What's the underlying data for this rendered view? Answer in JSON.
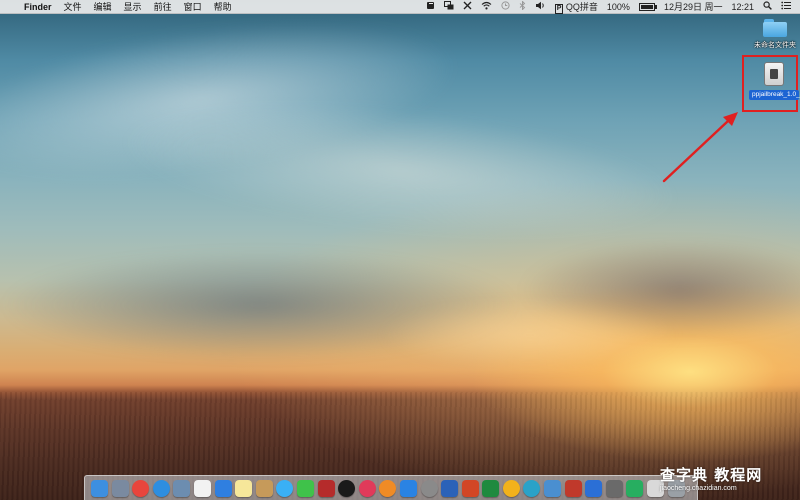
{
  "menubar": {
    "apple": "",
    "app_name": "Finder",
    "menus": [
      "文件",
      "编辑",
      "显示",
      "前往",
      "窗口",
      "帮助"
    ],
    "status": {
      "ime_box": "P",
      "ime_name": "QQ拼音",
      "battery_percent": "100%",
      "battery_level": 1.0,
      "date": "12月29日 周一",
      "time": "12:21"
    },
    "status_icons": [
      "evernote-icon",
      "screen-sharing-icon",
      "tools-icon",
      "wifi-icon",
      "time-machine-icon",
      "bluetooth-icon",
      "volume-icon",
      "input-method-icon",
      "battery-icon",
      "spotlight-icon",
      "notification-center-icon"
    ]
  },
  "desktop": {
    "folder": {
      "label": "未命名文件夹"
    },
    "dmg": {
      "label": "ppjailbreak_1.0_2....dmg"
    }
  },
  "dock": {
    "apps": [
      {
        "name": "finder-icon",
        "color": "#3d8fe0"
      },
      {
        "name": "launchpad-icon",
        "color": "#7a8aa0"
      },
      {
        "name": "chrome-icon",
        "color": "#e8453c"
      },
      {
        "name": "safari-icon",
        "color": "#2e8ee0"
      },
      {
        "name": "preview-icon",
        "color": "#6c8db0"
      },
      {
        "name": "calendar-icon",
        "color": "#f2f2f2"
      },
      {
        "name": "app-store-icon",
        "color": "#2f7fe0"
      },
      {
        "name": "notes-icon",
        "color": "#f6e79a"
      },
      {
        "name": "contacts-icon",
        "color": "#c69a5a"
      },
      {
        "name": "messages-icon",
        "color": "#3ab0f5"
      },
      {
        "name": "facetime-icon",
        "color": "#3fc24a"
      },
      {
        "name": "photo-booth-icon",
        "color": "#b52b2b"
      },
      {
        "name": "qq-icon",
        "color": "#1a1a1a"
      },
      {
        "name": "itunes-icon",
        "color": "#e03a5a"
      },
      {
        "name": "ibooks-icon",
        "color": "#f08b25"
      },
      {
        "name": "app-store-blue-icon",
        "color": "#2a83e3"
      },
      {
        "name": "system-preferences-icon",
        "color": "#8a8a8a"
      },
      {
        "name": "word-icon",
        "color": "#2b62b8"
      },
      {
        "name": "powerpoint-icon",
        "color": "#d24625"
      },
      {
        "name": "excel-icon",
        "color": "#1f8a3f"
      },
      {
        "name": "outlook-icon",
        "color": "#f2b21b"
      },
      {
        "name": "onenote-icon",
        "color": "#2aa2c8"
      },
      {
        "name": "image-capture-icon",
        "color": "#4a8fd0"
      },
      {
        "name": "crossover-icon",
        "color": "#c0392b"
      },
      {
        "name": "thunder-icon",
        "color": "#2b6fd6"
      },
      {
        "name": "screenshot-icon",
        "color": "#6a6a6a"
      },
      {
        "name": "activity-icon",
        "color": "#27ae60"
      },
      {
        "name": "downloads-stack-icon",
        "color": "#d9d9d9"
      },
      {
        "name": "trash-icon",
        "color": "#9aa0a6"
      }
    ]
  },
  "watermark": {
    "line1": "查字典 教程网",
    "line2": "jiaocheng.chazidian.com"
  },
  "colors": {
    "selection_box": "#e02020",
    "arrow": "#e02020",
    "dmg_label_bg": "#1c64d3"
  }
}
